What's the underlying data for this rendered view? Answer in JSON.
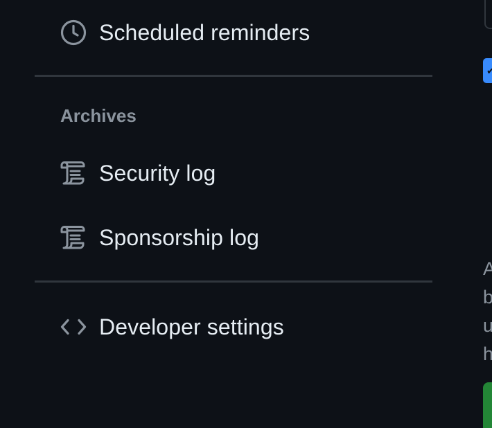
{
  "sidebar": {
    "items_top": [
      {
        "label": "Scheduled reminders",
        "icon": "clock-icon"
      }
    ],
    "archives": {
      "heading": "Archives",
      "items": [
        {
          "label": "Security log",
          "icon": "log-icon"
        },
        {
          "label": "Sponsorship log",
          "icon": "log-icon"
        }
      ]
    },
    "items_bottom": [
      {
        "label": "Developer settings",
        "icon": "code-icon"
      }
    ]
  },
  "right_clipped": {
    "checkbox_glyph": "✔",
    "text_lines": [
      "A",
      "b",
      "u",
      "h"
    ]
  },
  "colors": {
    "background": "#0d1117",
    "text": "#e6edf3",
    "muted": "#8b949e",
    "border": "#30363d",
    "accent": "#388bfd",
    "success": "#238636"
  }
}
